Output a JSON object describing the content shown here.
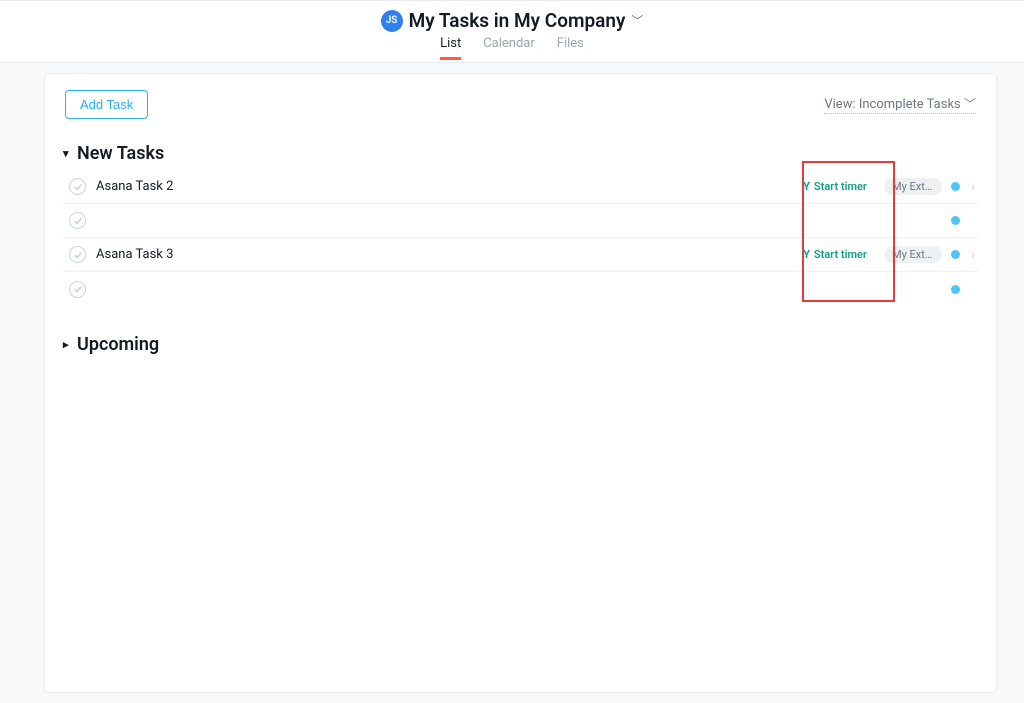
{
  "header": {
    "avatar_initials": "JS",
    "title": "My Tasks in My Company",
    "tabs": {
      "list": "List",
      "calendar": "Calendar",
      "files": "Files"
    }
  },
  "toolbar": {
    "add_task_label": "Add Task",
    "view_label": "View: Incomplete Tasks "
  },
  "sections": {
    "new_tasks": {
      "title": "New Tasks",
      "rows": [
        {
          "name": "Asana Task 2",
          "timer": "Start timer",
          "project": "My Extern..."
        },
        {
          "name": "",
          "timer": "",
          "project": ""
        },
        {
          "name": "Asana Task 3",
          "timer": "Start timer",
          "project": "My Extern..."
        },
        {
          "name": "",
          "timer": "",
          "project": ""
        }
      ]
    },
    "upcoming": {
      "title": "Upcoming"
    }
  },
  "icons": {
    "timer_glyph": "Y"
  }
}
